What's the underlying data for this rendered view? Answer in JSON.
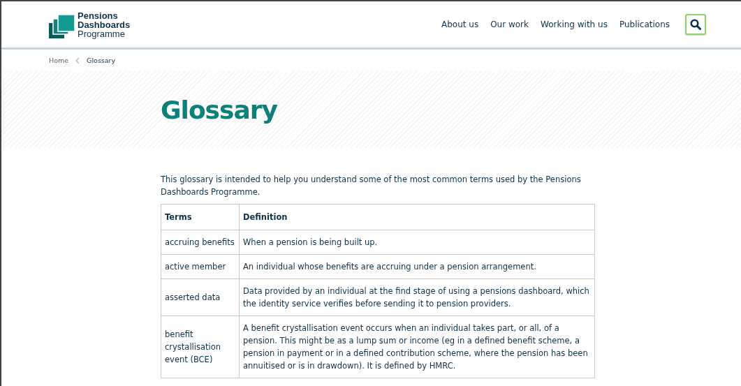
{
  "logo": {
    "lines": [
      "Pensions",
      "Dashboards",
      "Programme"
    ]
  },
  "nav": {
    "items": [
      "About us",
      "Our work",
      "Working with us",
      "Publications"
    ]
  },
  "breadcrumb": [
    "Home",
    "Glossary"
  ],
  "title": "Glossary",
  "intro": "This glossary is intended to help you understand some of the most common terms used by the Pensions Dashboards Programme.",
  "table": {
    "columns": [
      "Terms",
      "Definition"
    ],
    "rows": [
      {
        "term": "accruing benefits",
        "definition": "When a pension is being built up."
      },
      {
        "term": "active member",
        "definition": "An individual whose benefits are accruing under a pension arrangement."
      },
      {
        "term": "asserted data",
        "definition": "Data provided by an individual at the find stage of using a pensions dashboard, which the identity service verifies before sending it to pension providers."
      },
      {
        "term": "benefit crystallisation event (BCE)",
        "definition": "A benefit crystallisation event occurs when an individual takes part, or all, of a pension. This might be as a lump sum or income (eg in a defined benefit scheme, a pension in payment or in a defined contribution scheme, where the pension has been annuitised or is in drawdown). It is defined by HMRC."
      }
    ]
  }
}
